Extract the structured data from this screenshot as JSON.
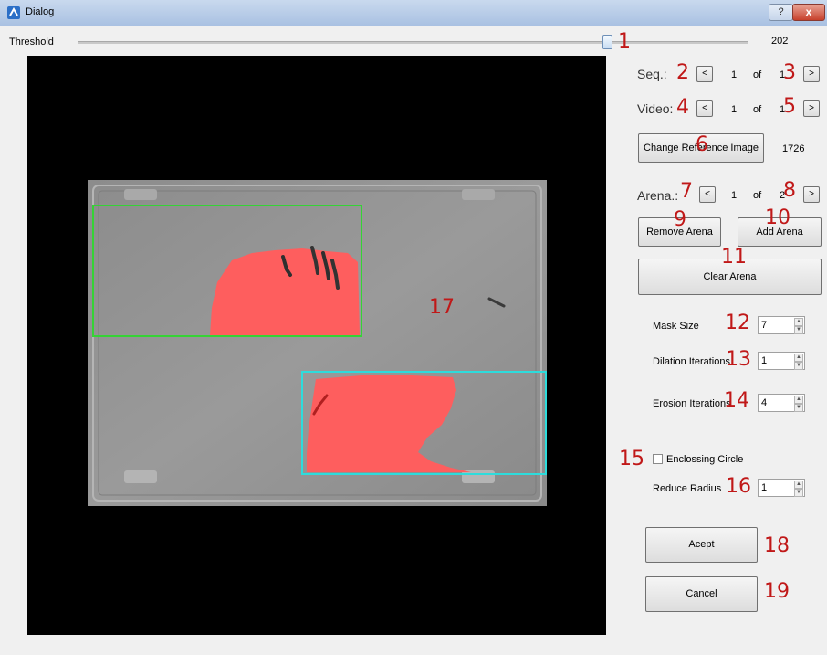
{
  "window": {
    "title": "Dialog",
    "help_label": "?",
    "close_label": "x"
  },
  "threshold": {
    "label": "Threshold",
    "value": "202",
    "annotation": "1",
    "level": 0.79
  },
  "seq": {
    "label": "Seq.:",
    "prev": "<",
    "current": "1",
    "of": "of",
    "total": "1",
    "next": ">",
    "ann_left": "2",
    "ann_right": "3"
  },
  "video": {
    "label": "Video:",
    "prev": "<",
    "current": "1",
    "of": "of",
    "total": "1",
    "next": ">",
    "ann_left": "4",
    "ann_right": "5"
  },
  "reference": {
    "button": "Change Reference Image",
    "count": "1726",
    "annotation": "6"
  },
  "arena": {
    "label": "Arena.:",
    "prev": "<",
    "current": "1",
    "of": "of",
    "total": "2",
    "next": ">",
    "ann_left": "7",
    "ann_right": "8"
  },
  "remove_arena": {
    "label": "Remove Arena",
    "annotation": "9"
  },
  "add_arena": {
    "label": "Add Arena",
    "annotation": "10"
  },
  "clear_arena": {
    "label": "Clear Arena",
    "annotation": "11"
  },
  "mask_size": {
    "label": "Mask Size",
    "value": "7",
    "annotation": "12"
  },
  "dilation": {
    "label": "Dilation Iterations",
    "value": "1",
    "annotation": "13"
  },
  "erosion": {
    "label": "Erosion Iterations",
    "value": "4",
    "annotation": "14"
  },
  "enclosing": {
    "label": "Enclossing Circle",
    "annotation": "15",
    "checked": false
  },
  "reduce_radius": {
    "label": "Reduce Radius",
    "value": "1",
    "annotation": "16"
  },
  "canvas": {
    "annotation": "17"
  },
  "accept": {
    "label": "Acept",
    "annotation": "18"
  },
  "cancel": {
    "label": "Cancel",
    "annotation": "19"
  },
  "colors": {
    "mask": "#fe5e5e",
    "arena_green": "#35d335",
    "arena_cyan": "#2ddcdc",
    "annotation": "#c01818"
  }
}
